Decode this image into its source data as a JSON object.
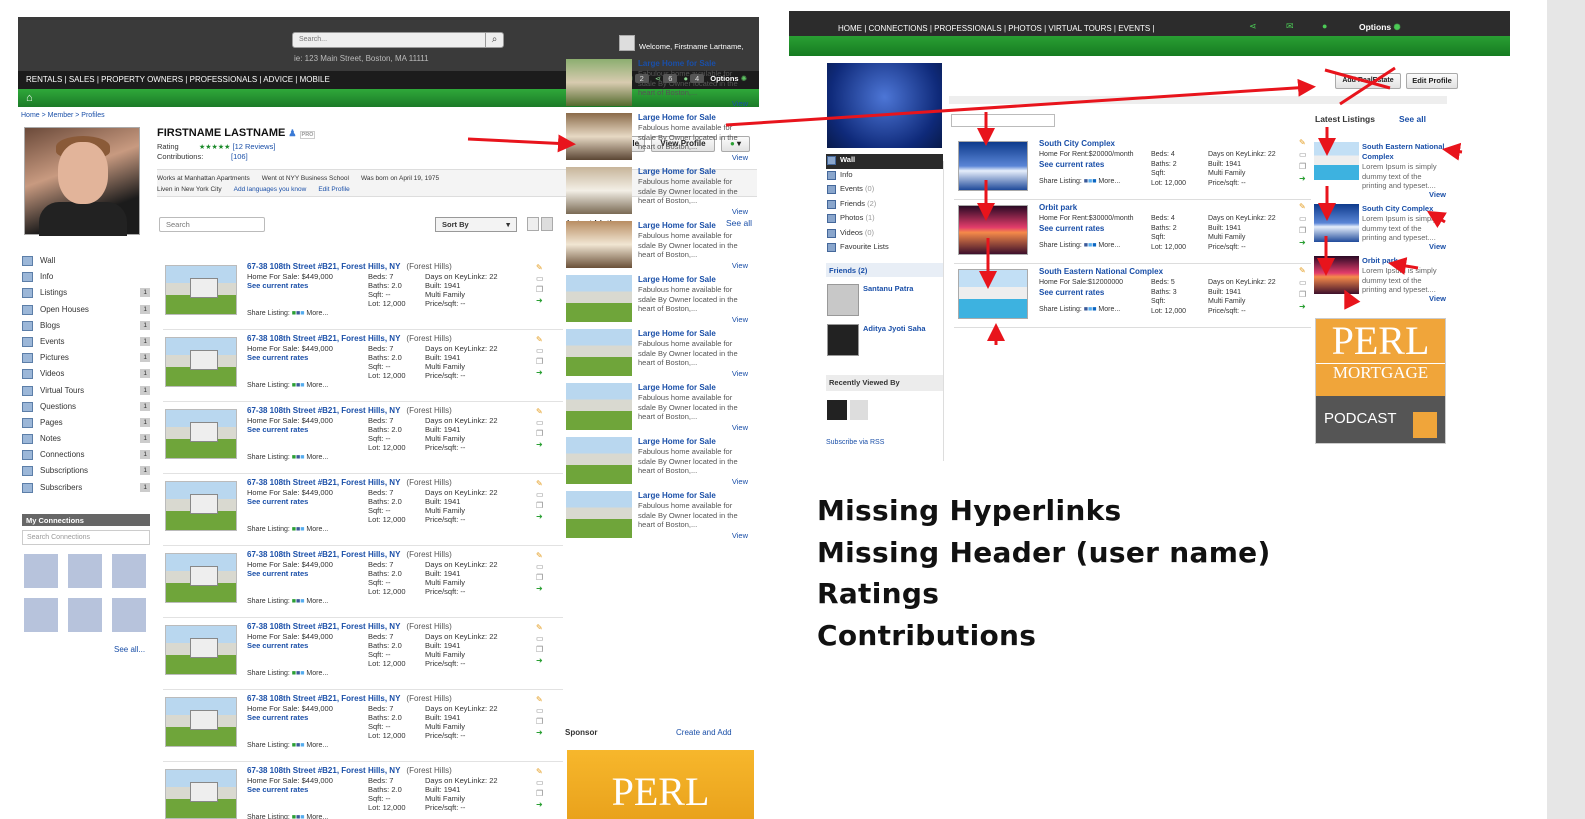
{
  "left": {
    "search_placeholder": "Search...",
    "search_hint": "ie: 123 Main Street, Boston, MA 11111",
    "welcome": "Welcome, Firstname Lartname,",
    "nav": "RENTALS | SALES | PROPERTY OWNERS | PROFESSIONALS | ADVICE | MOBILE",
    "counts": [
      "2",
      "6",
      "4"
    ],
    "options": "Options",
    "breadcrumb": "Home > Member > Profiles",
    "name": "FIRSTNAME LASTNAME",
    "pro": "PRO",
    "rating_label": "Rating",
    "rating_stars": "★★★★★",
    "reviews": "[12 Reviews]",
    "contrib_label": "Contributions:",
    "contrib_value": "[106]",
    "edit_profile": "Edit Profile",
    "view_profile": "View Profile",
    "info1": [
      "Works at Manhattan Apartments",
      "Went ot NYY Business School",
      "Was born on April 19, 1975"
    ],
    "info2": [
      "Liven in New York City",
      "Add languages you know",
      "Edit Profile"
    ],
    "side_items": [
      {
        "label": "Wall",
        "n": ""
      },
      {
        "label": "Info",
        "n": ""
      },
      {
        "label": "Listings",
        "n": "1"
      },
      {
        "label": "Open Houses",
        "n": "1"
      },
      {
        "label": "Blogs",
        "n": "1"
      },
      {
        "label": "Events",
        "n": "1"
      },
      {
        "label": "Pictures",
        "n": "1"
      },
      {
        "label": "Videos",
        "n": "1"
      },
      {
        "label": "Virtual Tours",
        "n": "1"
      },
      {
        "label": "Questions",
        "n": "1"
      },
      {
        "label": "Pages",
        "n": "1"
      },
      {
        "label": "Notes",
        "n": "1"
      },
      {
        "label": "Connections",
        "n": "1"
      },
      {
        "label": "Subscriptions",
        "n": "1"
      },
      {
        "label": "Subscribers",
        "n": "1"
      }
    ],
    "my_connections": "My Connections",
    "search_connections": "Search Connections",
    "see_all": "See all...",
    "listing_search": "Search",
    "sort_by": "Sort By",
    "listing": {
      "title": "67-38 108th Street #B21, Forest Hills, NY",
      "area": "(Forest Hills)",
      "price": "Home For Sale: $449,000",
      "rates": "See current rates",
      "beds": "Beds: 7",
      "baths": "Baths: 2.0",
      "sqft": "Sqft: --",
      "lot": "Lot: 12,000",
      "days": "Days on KeyLinkz: 22",
      "built": "Built: 1941",
      "type": "Multi Family",
      "ppsf": "Price/sqft: --",
      "share": "Share Listing:",
      "more": "More..."
    },
    "latest_title": "Latest Listings",
    "latest_seeall": "See all",
    "latest": {
      "title": "Large Home for Sale",
      "desc": "Fabulous home available for sdale By Owner located in the heart of Boston,...",
      "view": "View"
    },
    "sponsor": "Sponsor",
    "create_add": "Create and Add",
    "perl": "PERL"
  },
  "right": {
    "nav": "HOME  |  CONNECTIONS  |  PROFESSIONALS  |  PHOTOS  |  VIRTUAL TOURS  |  EVENTS  |",
    "options": "Options",
    "add_realestate": "Add RealEstate",
    "edit_profile": "Edit Profile",
    "side": [
      {
        "label": "Wall",
        "n": ""
      },
      {
        "label": "Info",
        "n": ""
      },
      {
        "label": "Events",
        "n": "(0)"
      },
      {
        "label": "Friends",
        "n": "(2)"
      },
      {
        "label": "Photos",
        "n": "(1)"
      },
      {
        "label": "Videos",
        "n": "(0)"
      },
      {
        "label": "Favourite Lists",
        "n": ""
      }
    ],
    "friends_title": "Friends (2)",
    "friends": [
      "Santanu Patra",
      "Aditya Jyoti Saha"
    ],
    "recently_viewed": "Recently Viewed By",
    "rss": "Subscribe via RSS",
    "listings": [
      {
        "title": "South City Complex",
        "price": "Home For Rent:$20000/month",
        "beds": "Beds: 4",
        "baths": "Baths: 2",
        "days": "Days on KeyLinkz: 22",
        "built": "Built: 1941"
      },
      {
        "title": "Orbit park",
        "price": "Home For Rent:$30000/month",
        "beds": "Beds: 4",
        "baths": "Baths: 2",
        "days": "Days on KeyLinkz: 22",
        "built": "Built: 1941"
      },
      {
        "title": "South Eastern National Complex",
        "price": "Home For Sale:$12000000",
        "beds": "Beds: 5",
        "baths": "Baths: 3",
        "days": "Days on KeyLinkz: 22",
        "built": "Built: 1941"
      }
    ],
    "listing_common": {
      "rates": "See current rates",
      "sqft": "Sqft:",
      "lot": "Lot: 12,000",
      "type": "Multi Family",
      "ppsf": "Price/sqft: --",
      "share": "Share Listing:",
      "more": "More..."
    },
    "latest_title": "Latest Listings",
    "latest_seeall": "See all",
    "latest": [
      {
        "title": "South Eastern National Complex",
        "desc": "Lorem Ipsum is simply dummy text of the printing and typeset....",
        "view": "View"
      },
      {
        "title": "South City Complex",
        "desc": "Lorem Ipsum is simply dummy text of the printing and typeset....",
        "view": "View"
      },
      {
        "title": "Orbit park",
        "desc": "Lorem Ipsum is simply dummy text of the printing and typeset....",
        "view": "View"
      }
    ],
    "perl_1": "PERL",
    "perl_2": "MORTGAGE",
    "perl_3": "PODCAST"
  },
  "notes": [
    "Missing Hyperlinks",
    "Missing Header (user name)",
    "Ratings",
    "Contributions"
  ],
  "colors": {
    "annotation": "#e8141c",
    "nav_green": "#1b8a2a",
    "link": "#1a4fa8"
  }
}
